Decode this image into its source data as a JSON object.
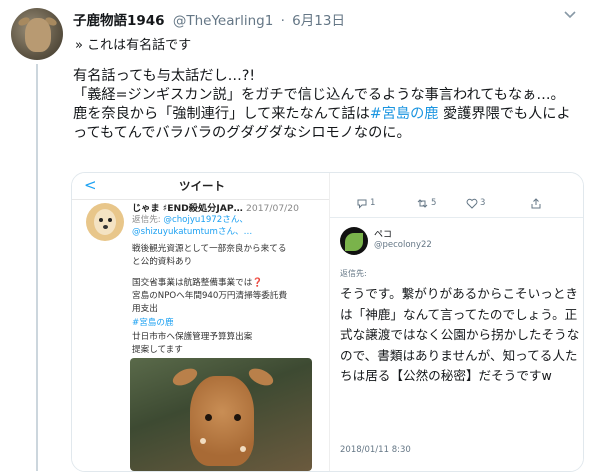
{
  "tweet": {
    "display_name": "子鹿物語1946",
    "handle": "@TheYearling1",
    "separator": "·",
    "date": "6月13日",
    "reply_line": "» これは有名話です",
    "body": [
      "有名話っても与太話だし…?!",
      "「義経=ジンギスカン説」をガチで信じ込んでるような事言われてもなぁ…。",
      "鹿を奈良から「強制連行」して来たなんて話は"
    ],
    "body_hashtag": "#宮島の鹿",
    "body_after_hashtag": " 愛護界隈でも人によってもてんでバラバラのグダグダなシロモノなのに。"
  },
  "left_shot": {
    "back_glyph": "<",
    "title": "ツイート",
    "author": "じゃま ♯END殺処分JAP…",
    "date": "2017/07/20",
    "reply_prefix": "返信先: ",
    "reply_mention": "@chojyu1972さん、",
    "reply_mention2": "@shizuyukatumtumさん、…",
    "lines": [
      "戦後観光資源として一部奈良から来てる",
      "と公的資料あり",
      "国交省事業は航路整備事業では",
      "宮島のNPOへ年間940万円清掃等委託費",
      "用支出"
    ],
    "question_mark": "❓",
    "hashtag": "#宮島の鹿",
    "after_lines": [
      "廿日市市へ保護管理予算算出案",
      "提案してます"
    ]
  },
  "right_shot": {
    "reply_count": "1",
    "retweet_count": "5",
    "like_count": "3",
    "name": "ペコ",
    "handle": "@pecolony22",
    "reply_label": "返信先:",
    "text": "そうです。繋がりがあるからこそいっときは「神鹿」なんて言ってたのでしょう。正式な譲渡ではなく公園から拐かしたそうなので、書類はありませんが、知ってる人たちは居る【公然の秘密】だそうですw",
    "timestamp": "2018/01/11 8:30"
  },
  "colors": {
    "link": "#1b95e0",
    "muted": "#657786",
    "text": "#14171a"
  }
}
